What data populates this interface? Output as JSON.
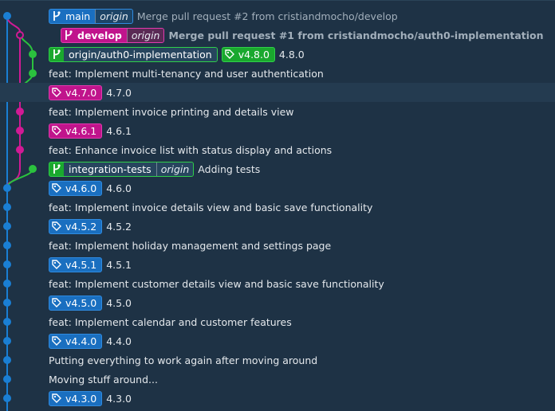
{
  "colors": {
    "background": "#1e3245",
    "main_lane": "#1a7fd4",
    "develop_lane": "#d11a95",
    "feature_lane": "#2bc23e"
  },
  "icons": {
    "branch": "git-branch-icon",
    "tag": "tag-icon"
  },
  "commits": [
    {
      "refs": [
        {
          "type": "branch",
          "name": "main",
          "remote": "origin",
          "color": "blue"
        }
      ],
      "message": "Merge pull request #2 from cristiandmocho/develop",
      "dim": true
    },
    {
      "refs": [
        {
          "type": "branch",
          "name": "develop",
          "remote": "origin",
          "color": "magenta",
          "bold": true
        }
      ],
      "message": "Merge pull request #1 from cristiandmocho/auth0-implementation",
      "dim": true,
      "bold": true
    },
    {
      "refs": [
        {
          "type": "branch",
          "name": "origin/auth0-implementation",
          "color": "green",
          "light": true
        },
        {
          "type": "tag",
          "name": "v4.8.0",
          "color": "green"
        }
      ],
      "message": "4.8.0"
    },
    {
      "refs": [],
      "message": "feat: Implement multi-tenancy and user authentication"
    },
    {
      "refs": [
        {
          "type": "tag",
          "name": "v4.7.0",
          "color": "magenta"
        }
      ],
      "message": "4.7.0"
    },
    {
      "refs": [],
      "message": "feat: Implement invoice printing and details view"
    },
    {
      "refs": [
        {
          "type": "tag",
          "name": "v4.6.1",
          "color": "magenta"
        }
      ],
      "message": "4.6.1"
    },
    {
      "refs": [],
      "message": "feat: Enhance invoice list with status display and actions"
    },
    {
      "refs": [
        {
          "type": "branch",
          "name": "integration-tests",
          "remote": "origin",
          "color": "green",
          "light": true
        }
      ],
      "message": "Adding tests"
    },
    {
      "refs": [
        {
          "type": "tag",
          "name": "v4.6.0",
          "color": "blue"
        }
      ],
      "message": "4.6.0"
    },
    {
      "refs": [],
      "message": "feat: Implement invoice details view and basic save functionality"
    },
    {
      "refs": [
        {
          "type": "tag",
          "name": "v4.5.2",
          "color": "blue"
        }
      ],
      "message": "4.5.2"
    },
    {
      "refs": [],
      "message": "feat: Implement holiday management and settings page"
    },
    {
      "refs": [
        {
          "type": "tag",
          "name": "v4.5.1",
          "color": "blue"
        }
      ],
      "message": "4.5.1"
    },
    {
      "refs": [],
      "message": "feat: Implement customer details view and basic save functionality"
    },
    {
      "refs": [
        {
          "type": "tag",
          "name": "v4.5.0",
          "color": "blue"
        }
      ],
      "message": "4.5.0"
    },
    {
      "refs": [],
      "message": "feat: Implement calendar and customer features"
    },
    {
      "refs": [
        {
          "type": "tag",
          "name": "v4.4.0",
          "color": "blue"
        }
      ],
      "message": "4.4.0"
    },
    {
      "refs": [],
      "message": "Putting everything to work again after moving around"
    },
    {
      "refs": [],
      "message": "Moving stuff around..."
    },
    {
      "refs": [
        {
          "type": "tag",
          "name": "v4.3.0",
          "color": "blue"
        }
      ],
      "message": "4.3.0"
    }
  ]
}
